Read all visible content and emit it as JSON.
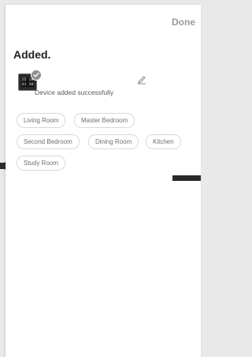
{
  "header": {
    "done_label": "Done"
  },
  "main": {
    "title": "Added.",
    "device": {
      "screen_text": "25 18\n31 39",
      "message": "Device added successfully"
    },
    "rooms": [
      "Living Room",
      "Master Bedroom",
      "Second Bedroom",
      "Dining Room",
      "Kitchen",
      "Study Room"
    ]
  },
  "icons": {
    "check": "check-icon",
    "edit": "pencil-icon",
    "left_arrow": "arrow-left-icon"
  }
}
